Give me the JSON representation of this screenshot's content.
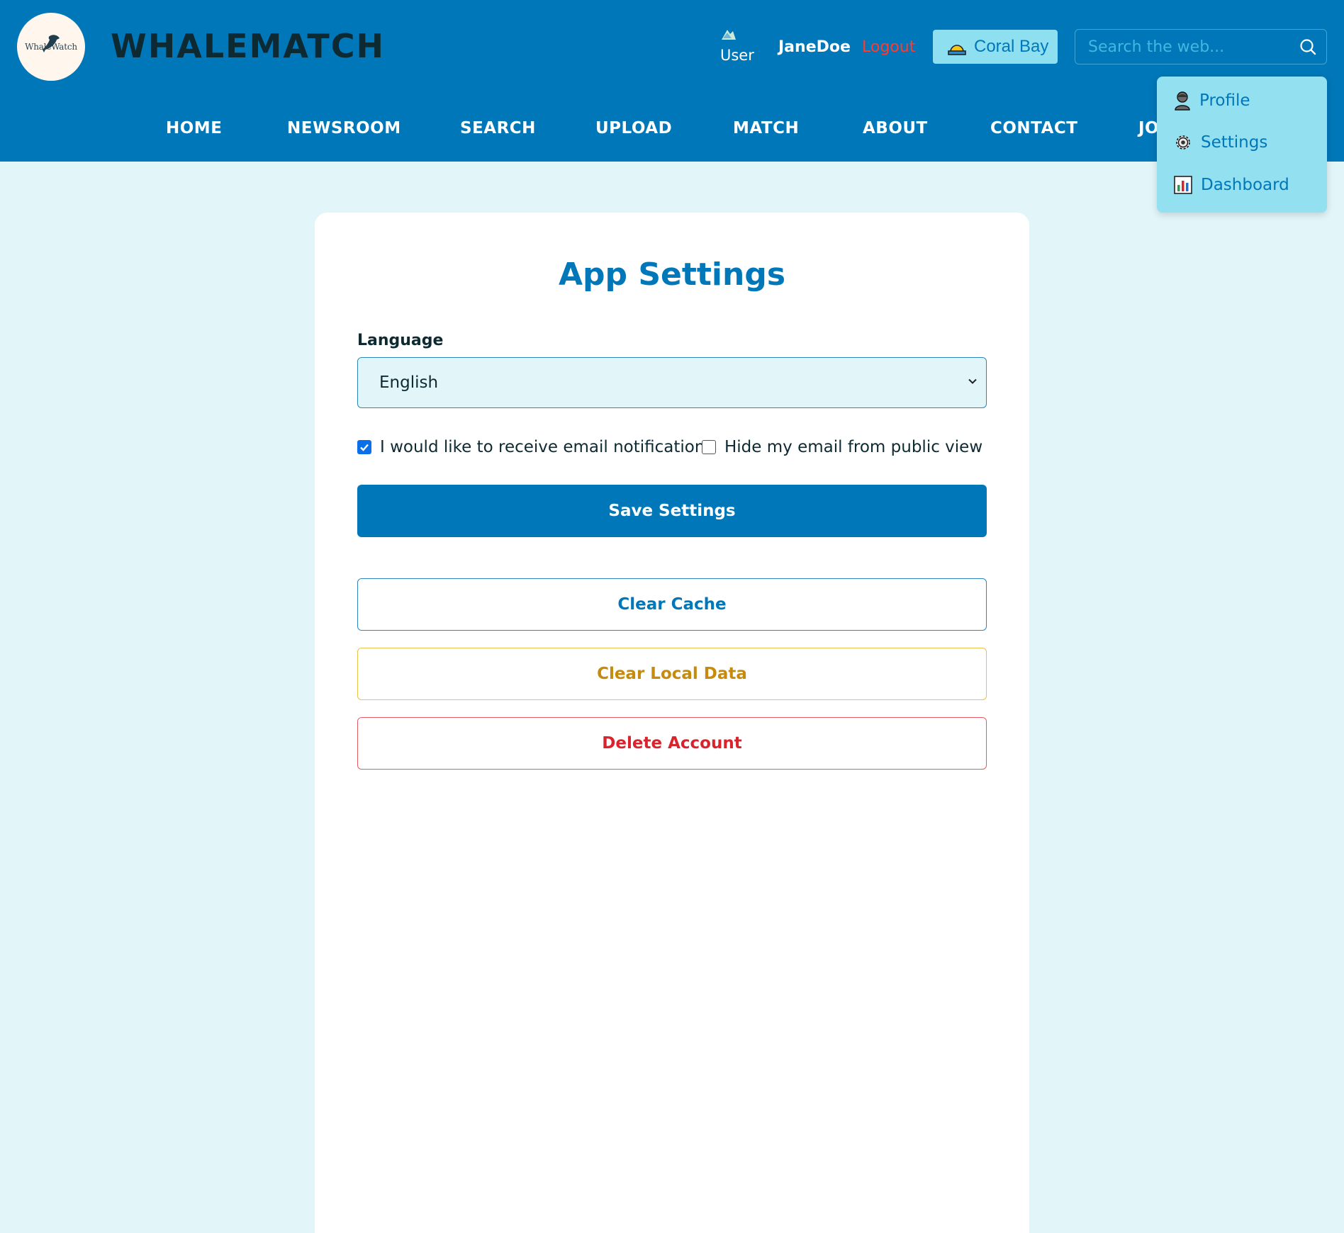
{
  "header": {
    "logo_text": "WhaleWatch",
    "brand": "WHALEMATCH",
    "user_avatar_alt": "User",
    "username": "JaneDoe",
    "logout_label": "Logout",
    "location_label": "Coral Bay",
    "search_placeholder": "Search the web..."
  },
  "nav": {
    "items": [
      "HOME",
      "NEWSROOM",
      "SEARCH",
      "UPLOAD",
      "MATCH",
      "ABOUT",
      "CONTACT",
      "JO"
    ]
  },
  "dropdown": {
    "items": [
      {
        "label": "Profile",
        "icon": "person-icon"
      },
      {
        "label": "Settings",
        "icon": "gear-icon"
      },
      {
        "label": "Dashboard",
        "icon": "bar-chart-icon"
      }
    ]
  },
  "settings": {
    "title": "App Settings",
    "language_label": "Language",
    "language_value": "English",
    "email_notifications_label": "I would like to receive email notifications",
    "email_notifications_checked": true,
    "hide_email_label": "Hide my email from public view",
    "hide_email_checked": false,
    "save_label": "Save Settings",
    "clear_cache_label": "Clear Cache",
    "clear_local_label": "Clear Local Data",
    "delete_account_label": "Delete Account"
  },
  "colors": {
    "header": "#0077b8",
    "background": "#e2f5f9",
    "dropdown": "#92e0f0",
    "warning": "#c68a0c",
    "danger": "#d9232d"
  }
}
